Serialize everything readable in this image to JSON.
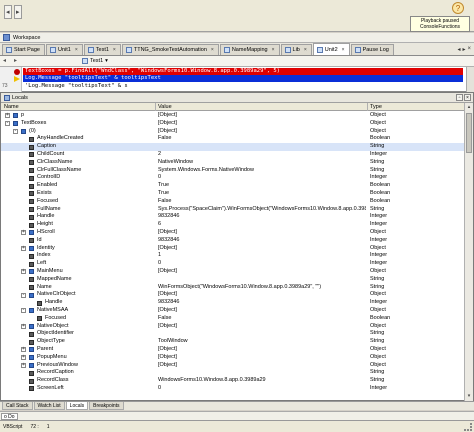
{
  "notification": {
    "icon": "help-question-icon",
    "text": "Playback paused ConsoleFunctions"
  },
  "workspace": {
    "label": "Workspace"
  },
  "tabs": [
    {
      "label": "Start Page",
      "active": false
    },
    {
      "label": "Unit1",
      "active": false
    },
    {
      "label": "Test1",
      "active": false
    },
    {
      "label": "TTNG_SmokeTestAutomation",
      "active": false
    },
    {
      "label": "NameMapping",
      "active": false
    },
    {
      "label": "Lib",
      "active": false
    },
    {
      "label": "Unit2",
      "active": true
    },
    {
      "label": "Pause Log",
      "active": false
    }
  ],
  "subbar": {
    "routine": "Test1"
  },
  "editor": {
    "line_number": "73",
    "lines": [
      "TextBoxes = p.FindAll(\"WndClass\", \"WindowsForms10.Window.8.app.0.3989a29\", 5)",
      "Log.Message \"tooltipsText\" & tooltipsText",
      "'Log.Message \"tooltipsText\" & s"
    ]
  },
  "locals": {
    "title": "Locals",
    "columns": {
      "name": "Name",
      "value": "Value",
      "type": "Type"
    },
    "rows": [
      {
        "indent": 0,
        "expander": "+",
        "name": "p",
        "value": "[Object]",
        "type": "Object"
      },
      {
        "indent": 0,
        "expander": "-",
        "name": "TextBoxes",
        "value": "[Object]",
        "type": "Object"
      },
      {
        "indent": 1,
        "expander": "-",
        "name": "(0)",
        "value": "[Object]",
        "type": "Object"
      },
      {
        "indent": 2,
        "expander": "",
        "name": "AnyHandleCreated",
        "value": "False",
        "type": "Boolean"
      },
      {
        "indent": 2,
        "expander": "",
        "name": "Caption",
        "value": "",
        "type": "String",
        "selected": true
      },
      {
        "indent": 2,
        "expander": "",
        "name": "ChildCount",
        "value": "2",
        "type": "Integer"
      },
      {
        "indent": 2,
        "expander": "",
        "name": "ClrClassName",
        "value": "NativeWindow",
        "type": "String"
      },
      {
        "indent": 2,
        "expander": "",
        "name": "ClrFullClassName",
        "value": "System.Windows.Forms.NativeWindow",
        "type": "String"
      },
      {
        "indent": 2,
        "expander": "",
        "name": "ControlID",
        "value": "0",
        "type": "Integer"
      },
      {
        "indent": 2,
        "expander": "",
        "name": "Enabled",
        "value": "True",
        "type": "Boolean"
      },
      {
        "indent": 2,
        "expander": "",
        "name": "Exists",
        "value": "True",
        "type": "Boolean"
      },
      {
        "indent": 2,
        "expander": "",
        "name": "Focused",
        "value": "False",
        "type": "Boolean"
      },
      {
        "indent": 2,
        "expander": "",
        "name": "FullName",
        "value": "Sys.Process(\"SpaceClaim\").WinFormsObject(\"WindowsForms10.Window.8.app.0.3989a29\", \"\")",
        "type": "String"
      },
      {
        "indent": 2,
        "expander": "",
        "name": "Handle",
        "value": "9832846",
        "type": "Integer"
      },
      {
        "indent": 2,
        "expander": "",
        "name": "Height",
        "value": "6",
        "type": "Integer"
      },
      {
        "indent": 2,
        "expander": "+",
        "name": "HScroll",
        "value": "[Object]",
        "type": "Object"
      },
      {
        "indent": 2,
        "expander": "",
        "name": "Id",
        "value": "9832846",
        "type": "Integer"
      },
      {
        "indent": 2,
        "expander": "+",
        "name": "Identity",
        "value": "[Object]",
        "type": "Object"
      },
      {
        "indent": 2,
        "expander": "",
        "name": "Index",
        "value": "1",
        "type": "Integer"
      },
      {
        "indent": 2,
        "expander": "",
        "name": "Left",
        "value": "0",
        "type": "Integer"
      },
      {
        "indent": 2,
        "expander": "+",
        "name": "MainMenu",
        "value": "[Object]",
        "type": "Object"
      },
      {
        "indent": 2,
        "expander": "",
        "name": "MappedName",
        "value": "",
        "type": "String"
      },
      {
        "indent": 2,
        "expander": "",
        "name": "Name",
        "value": "WinFormsObject(\"WindowsForms10.Window.8.app.0.3989a29\", \"\")",
        "type": "String"
      },
      {
        "indent": 2,
        "expander": "-",
        "name": "NativeClrObject",
        "value": "[Object]",
        "type": "Object"
      },
      {
        "indent": 3,
        "expander": "",
        "name": "Handle",
        "value": "9832846",
        "type": "Integer"
      },
      {
        "indent": 2,
        "expander": "-",
        "name": "NativeMSAA",
        "value": "[Object]",
        "type": "Object"
      },
      {
        "indent": 3,
        "expander": "",
        "name": "Focused",
        "value": "False",
        "type": "Boolean"
      },
      {
        "indent": 2,
        "expander": "+",
        "name": "NativeObject",
        "value": "[Object]",
        "type": "Object"
      },
      {
        "indent": 2,
        "expander": "",
        "name": "ObjectIdentifier",
        "value": "",
        "type": "String"
      },
      {
        "indent": 2,
        "expander": "",
        "name": "ObjectType",
        "value": "ToolWindow",
        "type": "String"
      },
      {
        "indent": 2,
        "expander": "+",
        "name": "Parent",
        "value": "[Object]",
        "type": "Object"
      },
      {
        "indent": 2,
        "expander": "+",
        "name": "PopupMenu",
        "value": "[Object]",
        "type": "Object"
      },
      {
        "indent": 2,
        "expander": "+",
        "name": "PreviousWindow",
        "value": "[Object]",
        "type": "Object"
      },
      {
        "indent": 2,
        "expander": "",
        "name": "RecordCaption",
        "value": "",
        "type": "String"
      },
      {
        "indent": 2,
        "expander": "",
        "name": "RecordClass",
        "value": "WindowsForms10.Window.8.app.0.3989a29",
        "type": "String"
      },
      {
        "indent": 2,
        "expander": "",
        "name": "ScreenLeft",
        "value": "0",
        "type": "Integer"
      }
    ]
  },
  "bottom_tabs": [
    {
      "label": "Call Stack",
      "active": false
    },
    {
      "label": "Watch List",
      "active": false
    },
    {
      "label": "Locals",
      "active": true
    },
    {
      "label": "Breakpoints",
      "active": false
    }
  ],
  "outline_label": "o Do",
  "status": {
    "language": "VBScript",
    "line_label": "72 :",
    "column": "1"
  }
}
